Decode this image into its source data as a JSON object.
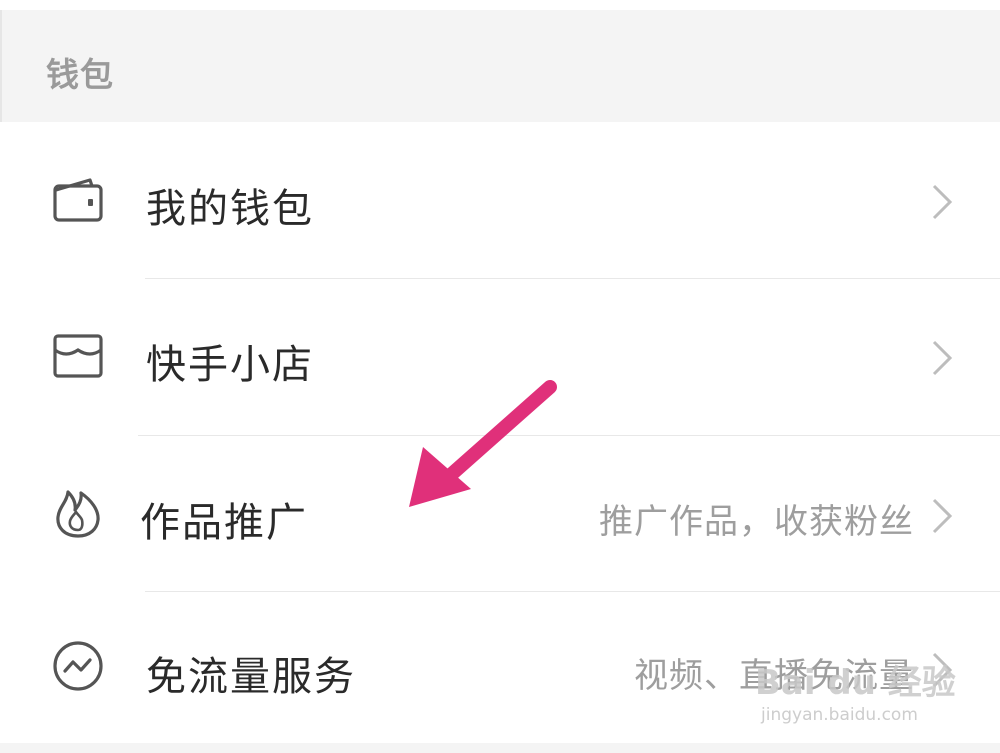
{
  "section": {
    "title": "钱包"
  },
  "items": [
    {
      "label": "我的钱包",
      "hint": "",
      "icon": "wallet-icon"
    },
    {
      "label": "快手小店",
      "hint": "",
      "icon": "shop-icon"
    },
    {
      "label": "作品推广",
      "hint": "推广作品，收获粉丝",
      "icon": "flame-icon"
    },
    {
      "label": "免流量服务",
      "hint": "视频、直播免流量",
      "icon": "data-wave-icon"
    }
  ],
  "annotation": {
    "arrow_color": "#e0307a"
  },
  "watermark": {
    "brand": "Bai du 经验",
    "url": "jingyan.baidu.com"
  },
  "colors": {
    "header_bg": "#f4f4f4",
    "text": "#2a2a2a",
    "hint": "#9e9e9e",
    "icon_stroke": "#555555"
  }
}
